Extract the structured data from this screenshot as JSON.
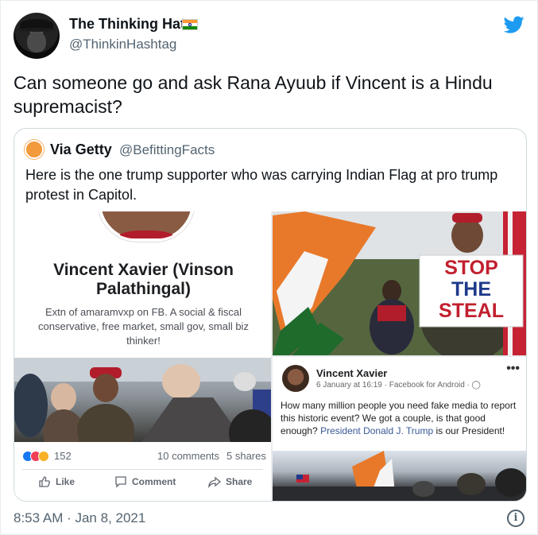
{
  "tweet": {
    "author_name": "The Thinking Hat",
    "author_handle": "@ThinkinHashtag",
    "text": "Can someone go and ask Rana Ayuub if Vincent is a Hindu supremacist?",
    "timestamp": "8:53 AM · Jan 8, 2021",
    "brand_color": "#1d9bf0"
  },
  "quoted": {
    "author_name": "Via Getty",
    "author_handle": "@BefittingFacts",
    "text": "Here is the one trump supporter who  was carrying Indian Flag at pro trump protest in Capitol."
  },
  "facebook_profile": {
    "name": "Vincent Xavier (Vinson Palathingal)",
    "bio": "Extn of amaramvxp on FB. A social & fiscal conservative, free market, small gov, small biz thinker!",
    "reactions_count": "152",
    "comments": "10 comments",
    "shares": "5 shares",
    "like_label": "Like",
    "comment_label": "Comment",
    "share_label": "Share"
  },
  "sign": {
    "line1": "STOP",
    "line2": "THE",
    "line3": "STEAL"
  },
  "facebook_post": {
    "name": "Vincent Xavier",
    "meta": "6 January at 16:19 · Facebook for Android · ",
    "more": "•••",
    "text_before": "How many million people you need fake media to report this historic event? We got a couple, is that good enough? ",
    "text_link": "President Donald J. Trump",
    "text_after": " is our President!"
  },
  "icons": [
    "twitter-bird-icon",
    "indian-flag-icon",
    "like-icon",
    "comment-icon",
    "share-icon",
    "info-icon",
    "globe-icon"
  ]
}
